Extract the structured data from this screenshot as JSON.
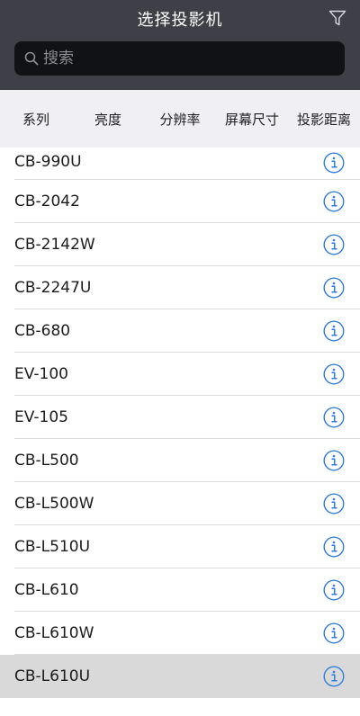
{
  "header": {
    "title": "选择投影机",
    "filter_icon": "filter-icon"
  },
  "search": {
    "placeholder": "搜索",
    "value": "",
    "icon": "search-icon"
  },
  "tabs": [
    "系列",
    "亮度",
    "分辨率",
    "屏幕尺寸",
    "投影距离"
  ],
  "projectors": [
    "CB-990U",
    "CB-2042",
    "CB-2142W",
    "CB-2247U",
    "CB-680",
    "EV-100",
    "EV-105",
    "CB-L500",
    "CB-L500W",
    "CB-L510U",
    "CB-L610",
    "CB-L610W",
    "CB-L610U"
  ],
  "selected_projector": "CB-L610U",
  "colors": {
    "header_bg": "#3f4047",
    "search_bg": "#101216",
    "tab_bar_bg": "#efeff4",
    "info_accent": "#2f7de1",
    "selected_row_bg": "#d9d9d9"
  }
}
